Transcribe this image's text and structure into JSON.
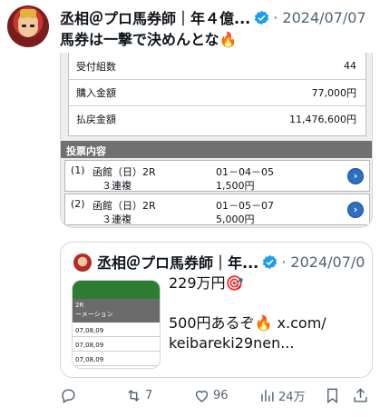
{
  "tweet": {
    "author_name": "丞相＠プロ馬券師｜年４億...",
    "date": "· 2024/07/07",
    "text": "馬券は一撃で決めんとな🔥"
  },
  "ticket": {
    "summary": [
      {
        "label": "受付組数",
        "value": "44"
      },
      {
        "label": "購入金額",
        "value": "77,000円"
      },
      {
        "label": "払戻金額",
        "value": "11,476,600円"
      }
    ],
    "bets_header": "投票内容",
    "bets": [
      {
        "no": "(1)",
        "race": "函館（日）2R",
        "type": "３連複",
        "combo": "01－04－05",
        "amount": "1,500円"
      },
      {
        "no": "(2)",
        "race": "函館（日）2R",
        "type": "３連複",
        "combo": "01－05－07",
        "amount": "5,000円"
      }
    ]
  },
  "quote": {
    "author_name": "丞相＠プロ馬券師｜年...",
    "date": "· 2024/07/07",
    "line1": "229万円🎯",
    "line2": "500円あるぞ🔥 x.com/",
    "line3": "keibareki29nen...",
    "thumb": {
      "label1": "2R",
      "label2": "ーメーション",
      "rows": [
        "07,08,09",
        "07,08,09",
        "07,08,09"
      ]
    }
  },
  "actions": {
    "reply_count": "",
    "retweet_count": "7",
    "like_count": "96",
    "views_count": "24万"
  },
  "colors": {
    "verified": "#1d9bf0",
    "muted": "#536471",
    "bet_header_bg": "#707070"
  }
}
